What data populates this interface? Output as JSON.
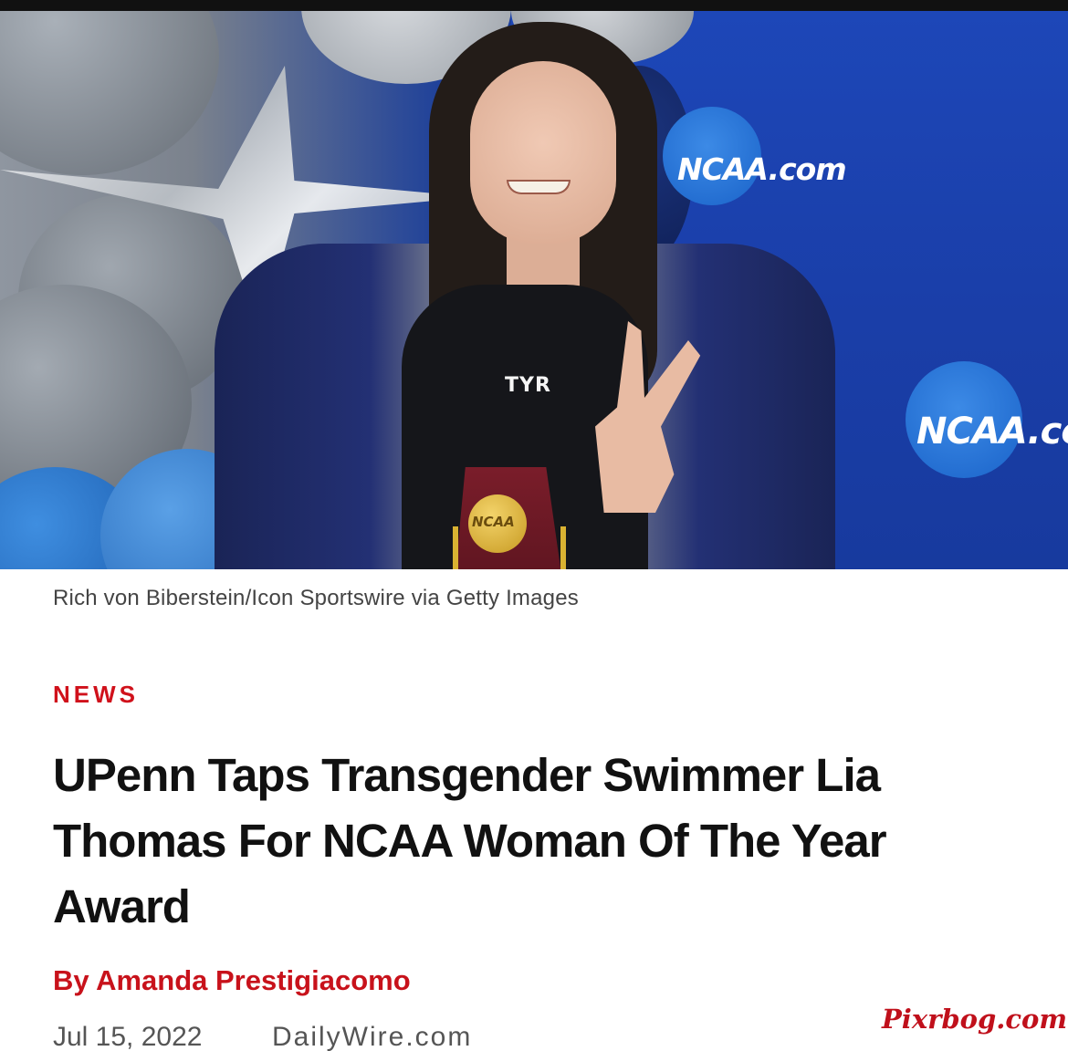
{
  "hero_image": {
    "alt": "Swimmer holding NCAA trophy",
    "backdrop_logo_texts": [
      "NCAA.com",
      "NCAA.co"
    ],
    "suit_brand": "TYR",
    "trophy_text": "NCAA"
  },
  "caption": "Rich von Biberstein/Icon Sportswire via Getty Images",
  "article": {
    "section": "NEWS",
    "headline": "UPenn Taps Transgender Swimmer Lia Thomas For NCAA Woman Of The Year Award",
    "byline": "By Amanda Prestigiacomo",
    "date": "Jul 15, 2022",
    "source": "DailyWire.com"
  },
  "watermark": "Pixrbog.com",
  "colors": {
    "accent_red": "#d0111b",
    "headline": "#111111",
    "meta_gray": "#555555"
  }
}
